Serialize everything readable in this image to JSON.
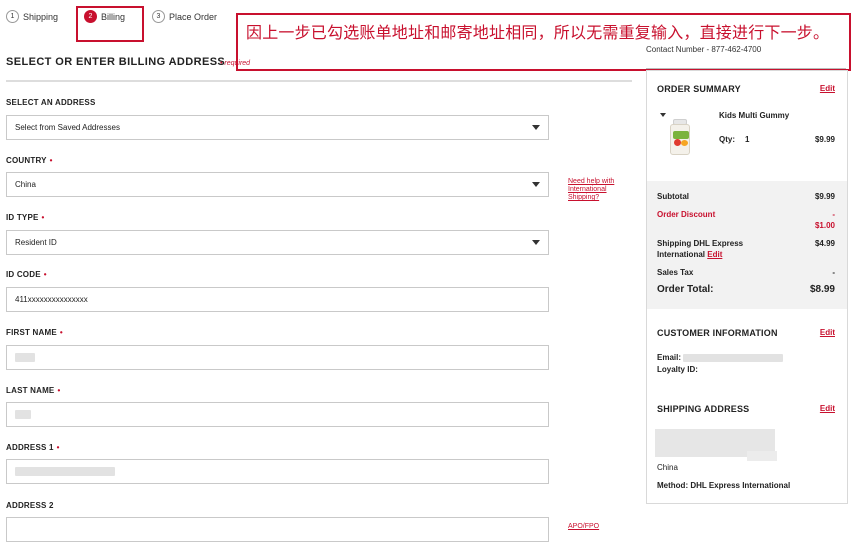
{
  "steps": [
    {
      "num": "1",
      "label": "Shipping"
    },
    {
      "num": "2",
      "label": "Billing"
    },
    {
      "num": "3",
      "label": "Place Order"
    }
  ],
  "annotation": "因上一步已勾选账单地址和邮寄地址相同，所以无需重复输入，直接进行下一步。",
  "contact": "Contact Number - 877-462-4700",
  "form": {
    "title": "SELECT OR ENTER BILLING ADDRESS",
    "required_note": "• required",
    "select_address": {
      "label": "SELECT AN ADDRESS",
      "value": "Select from Saved Addresses"
    },
    "country": {
      "label": "COUNTRY",
      "value": "China"
    },
    "id_type": {
      "label": "ID TYPE",
      "value": "Resident ID"
    },
    "id_code": {
      "label": "ID CODE",
      "value": "411xxxxxxxxxxxxxxx"
    },
    "first_name": {
      "label": "FIRST NAME"
    },
    "last_name": {
      "label": "LAST NAME"
    },
    "address1": {
      "label": "ADDRESS 1"
    },
    "address2": {
      "label": "ADDRESS 2"
    },
    "required_dot": "•",
    "help_link": "Need help with International Shipping?",
    "apo_link": "APO/FPO"
  },
  "summary": {
    "title": "ORDER SUMMARY",
    "edit": "Edit",
    "item_name": "Kids Multi Gummy",
    "qty_label": "Qty:",
    "qty": "1",
    "item_price": "$9.99",
    "subtotal_label": "Subtotal",
    "subtotal": "$9.99",
    "discount_label": "Order Discount",
    "discount_dash": "-",
    "discount": "$1.00",
    "shipping_label": "Shipping DHL Express International",
    "shipping_line1": "Shipping DHL Express",
    "shipping_line2": "International",
    "shipping_edit": "Edit",
    "shipping": "$4.99",
    "tax_label": "Sales Tax",
    "tax": "-",
    "total_label": "Order Total:",
    "total": "$8.99"
  },
  "customer": {
    "title": "CUSTOMER INFORMATION",
    "edit": "Edit",
    "email_label": "Email:",
    "loyalty_label": "Loyalty ID:"
  },
  "shipping_address": {
    "title": "SHIPPING ADDRESS",
    "edit": "Edit",
    "country": "China",
    "method": "Method: DHL Express International"
  },
  "colors": {
    "accent": "#c8102e",
    "border": "#c9c9c9",
    "band": "#f2f2f2"
  }
}
